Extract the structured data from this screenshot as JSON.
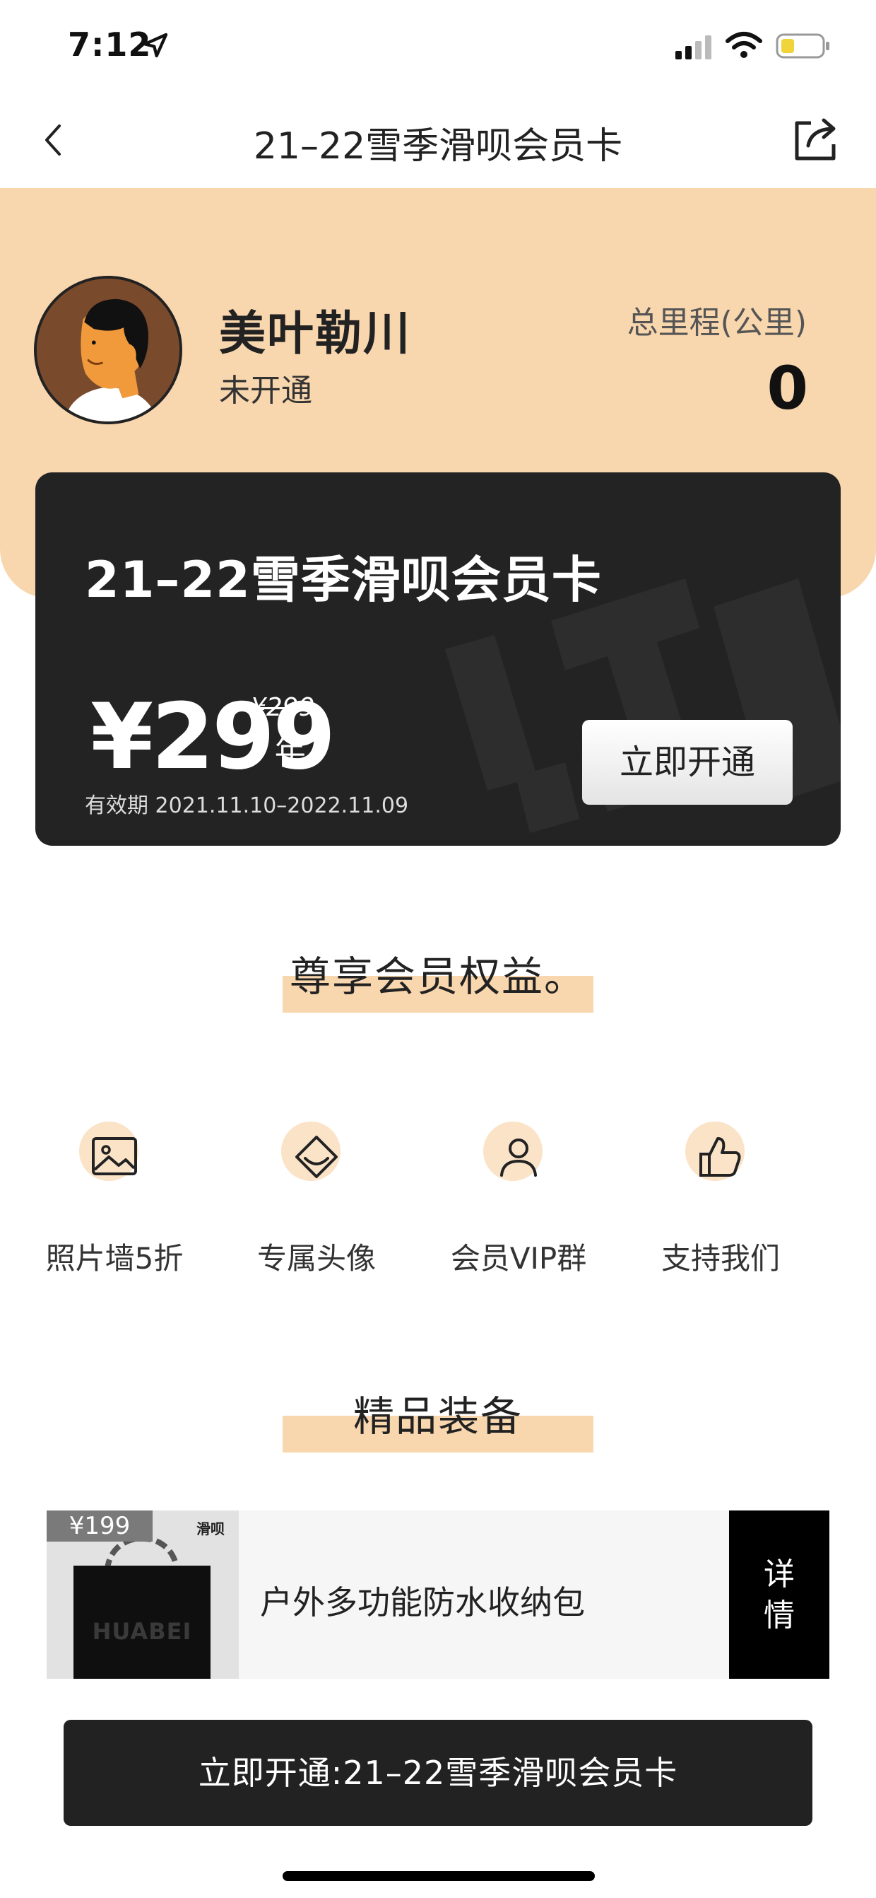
{
  "status_bar": {
    "time": "7:12"
  },
  "nav": {
    "title": "21–22雪季滑呗会员卡"
  },
  "profile": {
    "name": "美叶勒川",
    "status": "未开通",
    "mileage_label": "总里程(公里)",
    "mileage_value": "0"
  },
  "card": {
    "title": "21–22雪季滑呗会员卡",
    "price": "¥299",
    "original_price": "¥299",
    "per_year": "/ 年",
    "validity": "有效期  2021.11.10–2022.11.09",
    "button_label": "立即开通"
  },
  "benefits": {
    "title": "尊享会员权益。",
    "items": [
      {
        "label": "照片墙5折",
        "icon": "photo-icon"
      },
      {
        "label": "专属头像",
        "icon": "diamond-icon"
      },
      {
        "label": "会员VIP群",
        "icon": "person-icon"
      },
      {
        "label": "支持我们",
        "icon": "thumbs-up-icon"
      }
    ]
  },
  "gear": {
    "title": "精品装备",
    "product": {
      "price": "¥199",
      "brand": "滑呗",
      "bag_text": "HUABEI",
      "name": "户外多功能防水收纳包",
      "detail_label": "详\n情"
    }
  },
  "bottom_cta": {
    "label": "立即开通:21–22雪季滑呗会员卡"
  },
  "colors": {
    "accent": "#f8d6ae",
    "card": "#232323"
  }
}
